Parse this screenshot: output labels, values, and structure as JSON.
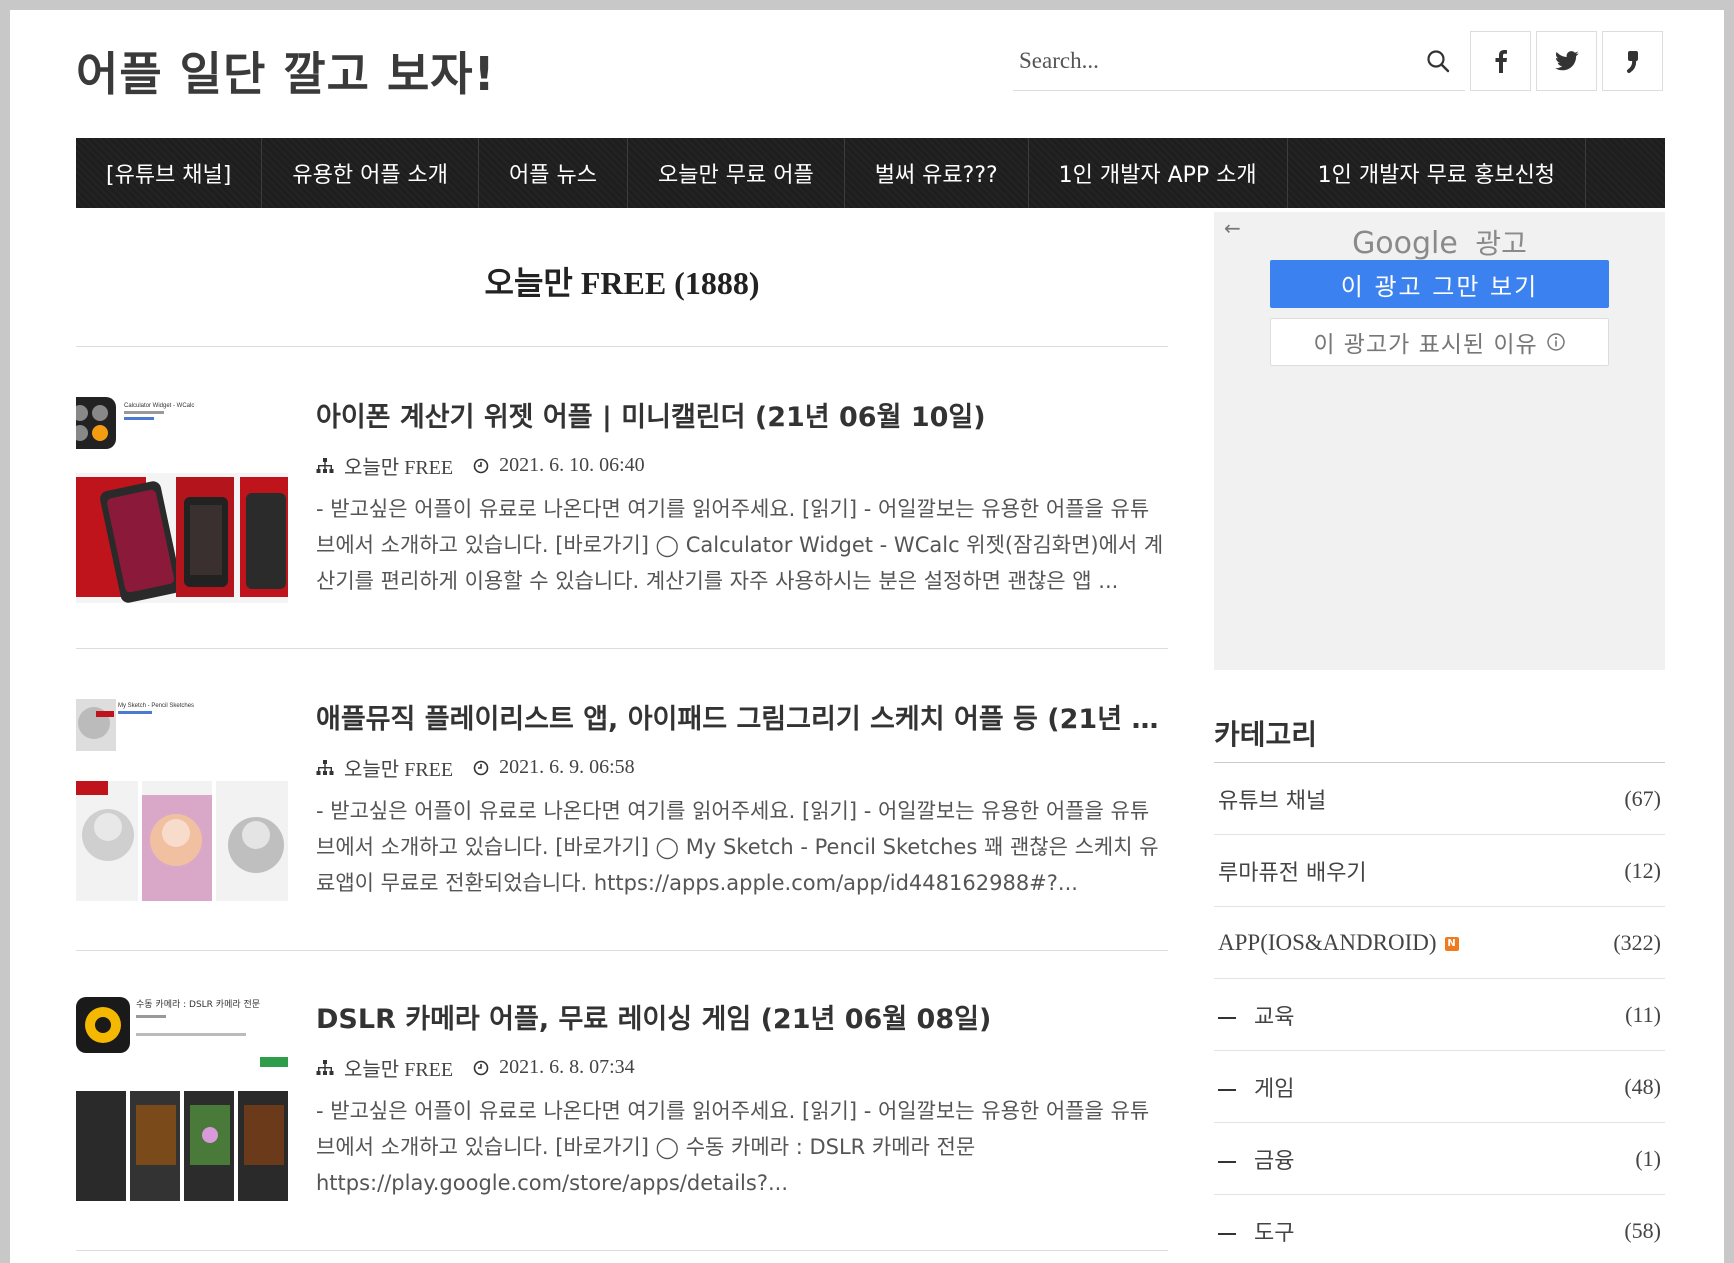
{
  "header": {
    "site_title": "어플 일단 깔고 보자!",
    "search_placeholder": "Search...",
    "social": [
      {
        "icon": "facebook-icon",
        "glyph": "f"
      },
      {
        "icon": "twitter-icon",
        "glyph": "t"
      },
      {
        "icon": "tistory-icon",
        "glyph": "❜"
      }
    ]
  },
  "nav": {
    "items": [
      "[유튜브 채널]",
      "유용한 어플 소개",
      "어플 뉴스",
      "오늘만 무료 어플",
      "벌써 유료???",
      "1인 개발자 APP 소개",
      "1인 개발자 무료 홍보신청"
    ]
  },
  "main": {
    "heading": "오늘만 FREE (1888)",
    "posts": [
      {
        "title": "아이폰 계산기 위젯 어플 | 미니캘린더 (21년 06월 10일)",
        "category": "오늘만 FREE",
        "date": "2021. 6. 10. 06:40",
        "excerpt": "- 받고싶은 어플이 유료로 나온다면 여기를 읽어주세요. [읽기] - 어일깔보는 유용한 어플을 유튜브에서 소개하고 있습니다. [바로가기] ◯ Calculator Widget - WCalc 위젯(잠김화면)에서 계산기를 편리하게 이용할 수 있습니다. 계산기를 자주 사용하시는 분은 설정하면 괜찮은 앱 ...",
        "thumb_app": "Calculator Widget - WCalc"
      },
      {
        "title": "애플뮤직 플레이리스트 앱, 아이패드 그림그리기 스케치 어플 등 (21년 06월 ...",
        "category": "오늘만 FREE",
        "date": "2021. 6. 9. 06:58",
        "excerpt": "- 받고싶은 어플이 유료로 나온다면 여기를 읽어주세요. [읽기] - 어일깔보는 유용한 어플을 유튜브에서 소개하고 있습니다. [바로가기] ◯ My Sketch - Pencil Sketches 꽤 괜찮은 스케치 유료앱이 무료로 전환되었습니다. https://apps.apple.com/app/id448162988#?...",
        "thumb_app": "My Sketch - Pencil Sketches"
      },
      {
        "title": "DSLR 카메라 어플, 무료 레이싱 게임 (21년 06월 08일)",
        "category": "오늘만 FREE",
        "date": "2021. 6. 8. 07:34",
        "excerpt": "- 받고싶은 어플이 유료로 나온다면 여기를 읽어주세요. [읽기] - 어일깔보는 유용한 어플을 유튜브에서 소개하고 있습니다. [바로가기] ◯ 수동 카메라 : DSLR 카메라 전문 https://play.google.com/store/apps/details?...",
        "thumb_app": "수동 카메라 : DSLR 카메라 전문"
      }
    ]
  },
  "ad": {
    "brand": "Google",
    "brand_suffix": "광고",
    "stop_button": "이 광고 그만 보기",
    "why_button": "이 광고가 표시된 이유"
  },
  "sidebar": {
    "category_title": "카테고리",
    "categories": [
      {
        "name": "유튜브 채널",
        "count": "(67)"
      },
      {
        "name": "루마퓨전 배우기",
        "count": "(12)"
      },
      {
        "name": "APP(IOS&ANDROID)",
        "count": "(322)"
      },
      {
        "name": "교육",
        "count": "(11)"
      },
      {
        "name": "게임",
        "count": "(48)"
      },
      {
        "name": "금융",
        "count": "(1)"
      },
      {
        "name": "도구",
        "count": "(58)"
      }
    ]
  },
  "colors": {
    "nav_bg": "#1e1e1e",
    "ad_button": "#3b82f0",
    "new_badge": "#f07b1f"
  }
}
